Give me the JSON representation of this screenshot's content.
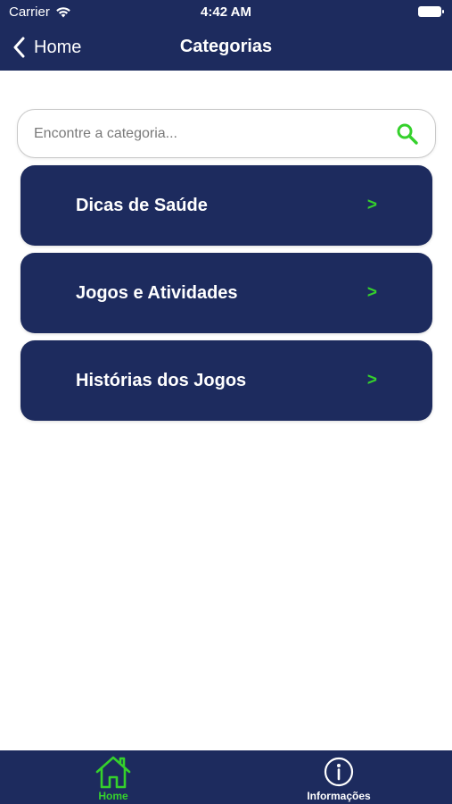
{
  "status_bar": {
    "carrier": "Carrier",
    "time": "4:42 AM"
  },
  "nav": {
    "back_label": "Home",
    "title": "Categorias"
  },
  "search": {
    "placeholder": "Encontre a categoria...",
    "value": ""
  },
  "categories": [
    {
      "label": "Dicas de Saúde",
      "arrow": ">"
    },
    {
      "label": "Jogos e Atividades",
      "arrow": ">"
    },
    {
      "label": "Histórias dos Jogos",
      "arrow": ">"
    }
  ],
  "tabs": [
    {
      "label": "Home",
      "icon": "house-icon",
      "active": true
    },
    {
      "label": "Informações",
      "icon": "info-circle-icon",
      "active": false
    }
  ],
  "colors": {
    "navy": "#1d2b5e",
    "accent_green": "#35d12c",
    "background": "#ffffff"
  }
}
